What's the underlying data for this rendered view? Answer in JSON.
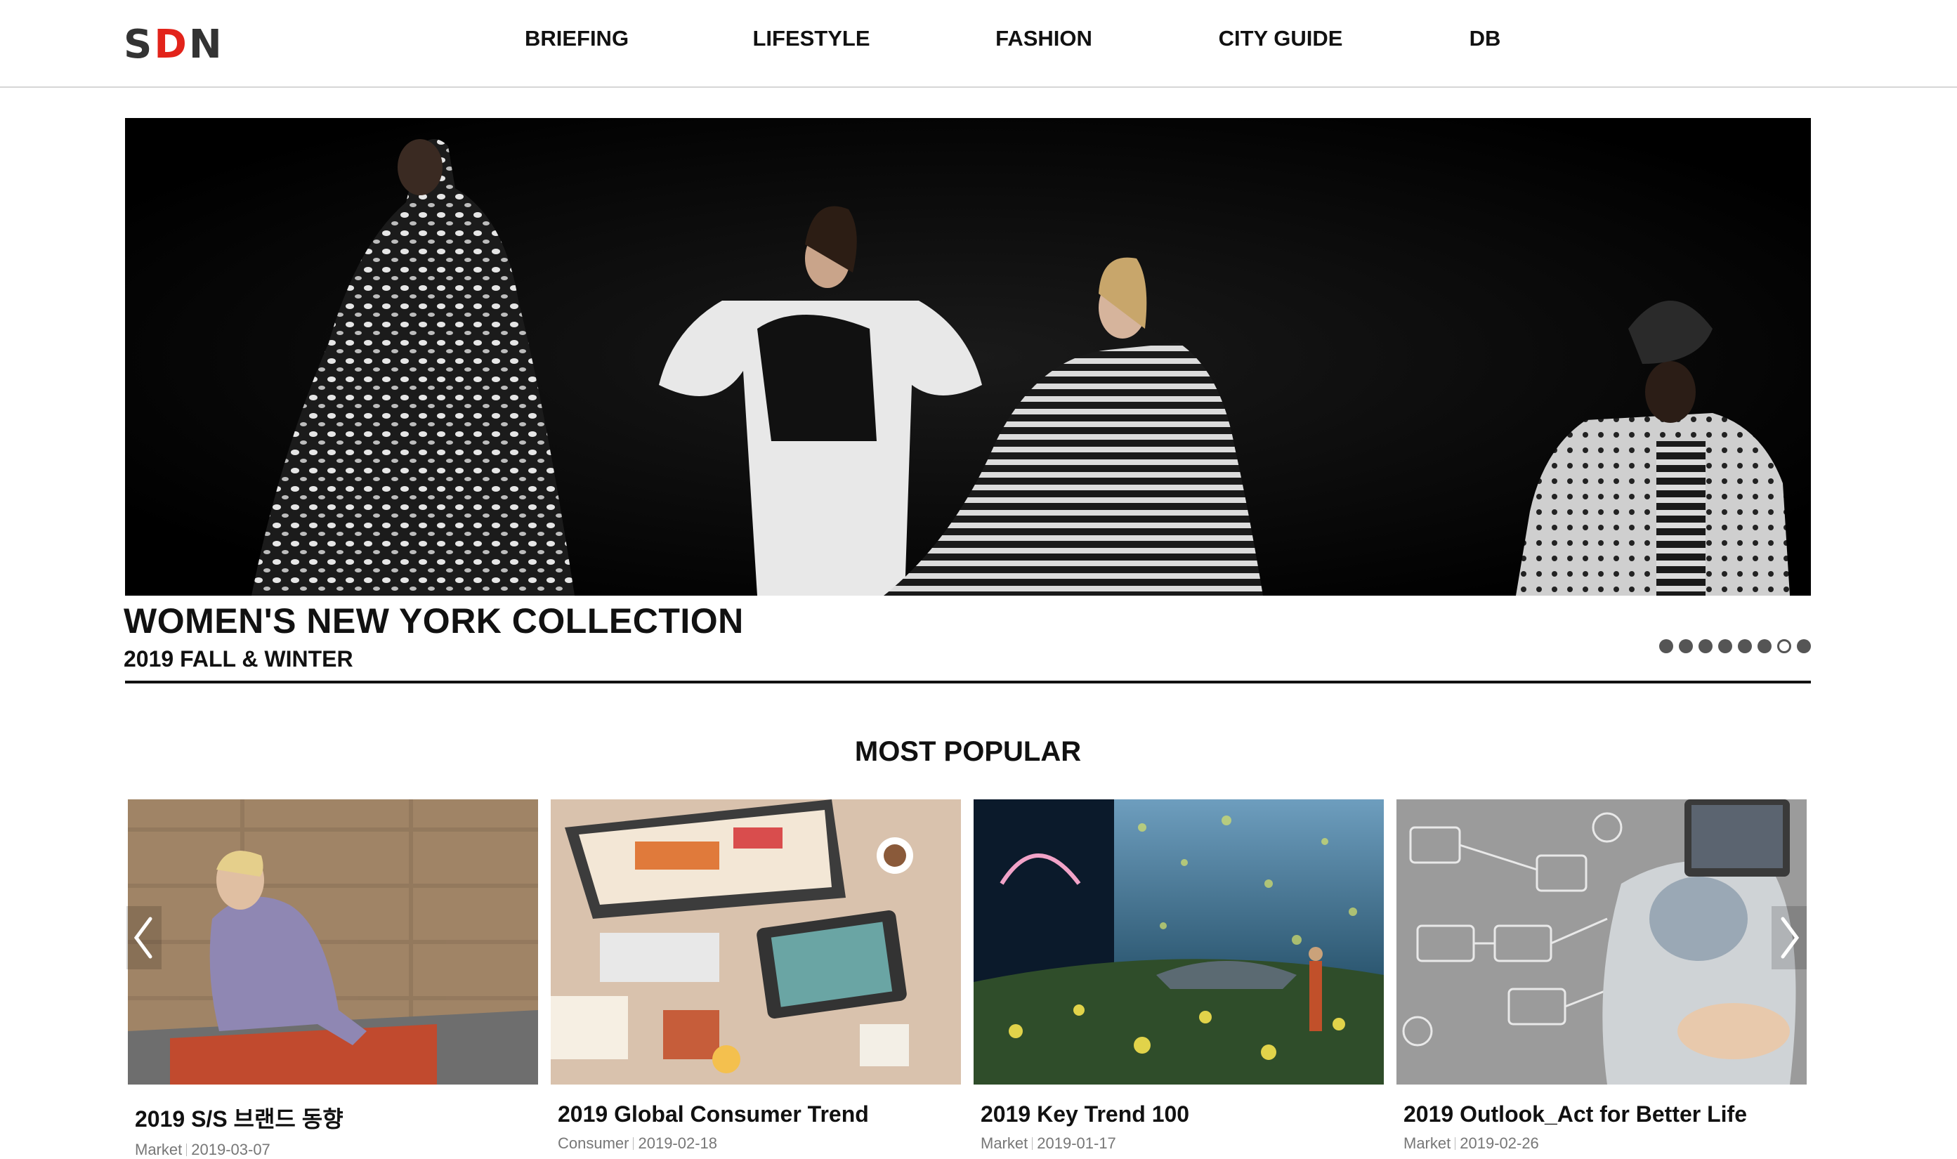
{
  "logo": {
    "letters": [
      "S",
      "D",
      "N"
    ]
  },
  "nav": {
    "items": [
      {
        "label": "BRIEFING"
      },
      {
        "label": "LIFESTYLE"
      },
      {
        "label": "FASHION"
      },
      {
        "label": "CITY GUIDE"
      },
      {
        "label": "DB"
      }
    ]
  },
  "hero": {
    "title": "WOMEN'S NEW YORK COLLECTION",
    "subtitle": "2019 FALL & WINTER",
    "slide_count": 8,
    "active_slide": 7
  },
  "most_popular": {
    "title": "MOST POPULAR",
    "cards": [
      {
        "title": "2019 S/S 브랜드 동향",
        "category": "Market",
        "date": "2019-03-07"
      },
      {
        "title": "2019 Global Consumer Trend",
        "category": "Consumer",
        "date": "2019-02-18"
      },
      {
        "title": "2019 Key Trend 100",
        "category": "Market",
        "date": "2019-01-17"
      },
      {
        "title": "2019 Outlook_Act for Better Life",
        "category": "Market",
        "date": "2019-02-26"
      }
    ],
    "prev_icon": "chevron-left-icon",
    "next_icon": "chevron-right-icon"
  },
  "colors": {
    "logo_accent": "#e2231a",
    "hero_background": "#050505",
    "text": "#111111",
    "meta": "#777777"
  }
}
